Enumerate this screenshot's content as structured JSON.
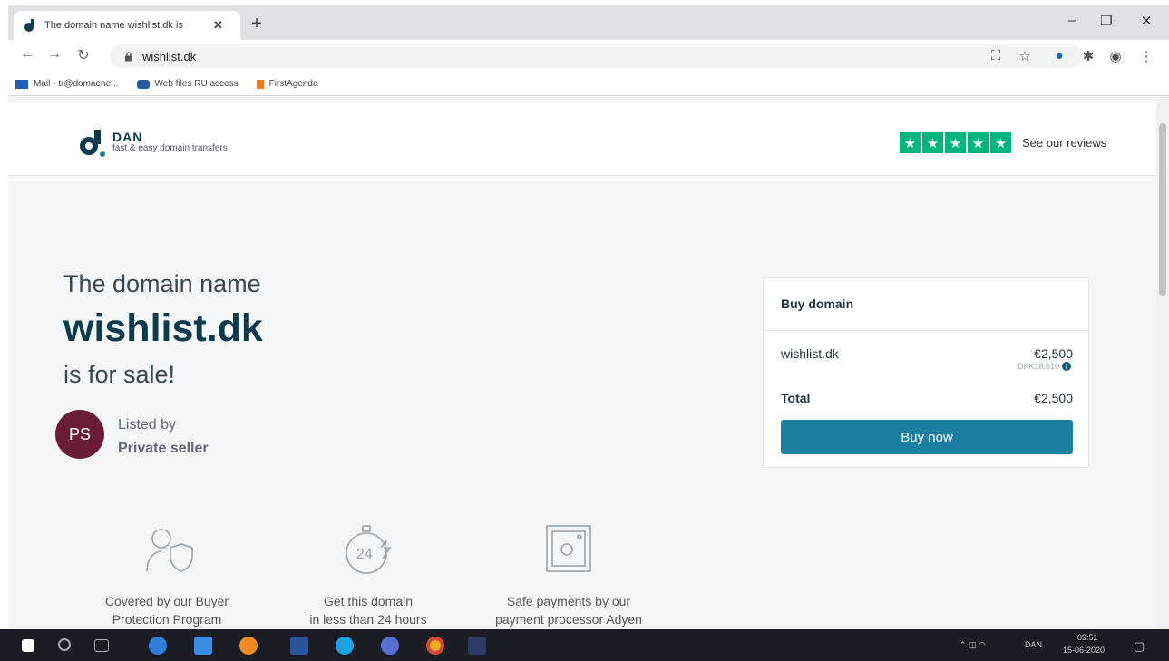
{
  "browser": {
    "tab_title": "The domain name wishlist.dk is",
    "url": "wishlist.dk",
    "bookmarks": [
      {
        "label": "Mail - tr@domaene...",
        "icon": "outlook-icon"
      },
      {
        "label": "Web files RU access",
        "icon": "web-files-icon"
      },
      {
        "label": "FirstAgenda",
        "icon": "firstagenda-icon"
      }
    ]
  },
  "site": {
    "logo_name": "DAN",
    "logo_tagline": "fast & easy domain transfers",
    "reviews_link": "See our reviews",
    "rating_stars": 5
  },
  "hero": {
    "line1": "The domain name",
    "domain": "wishlist.dk",
    "line3": "is for sale!"
  },
  "seller": {
    "initials": "PS",
    "listed_by": "Listed by",
    "name": "Private seller"
  },
  "buy_card": {
    "heading": "Buy domain",
    "domain": "wishlist.dk",
    "price": "€2,500",
    "price_dkk": "DKK18,610",
    "total_label": "Total",
    "total": "€2,500",
    "button": "Buy now"
  },
  "features": [
    {
      "line1": "Covered by our Buyer",
      "line2": "Protection Program"
    },
    {
      "line1": "Get this domain",
      "line2": "in less than 24 hours"
    },
    {
      "line1": "Safe payments by our",
      "line2": "payment processor Adyen"
    }
  ],
  "taskbar": {
    "time": "09:51",
    "date": "15-06-2020",
    "lang": "DAN"
  },
  "colors": {
    "brand_dark": "#0d3b4e",
    "button": "#1a7fa0",
    "trustpilot": "#00b67a",
    "avatar": "#6b1d36"
  }
}
